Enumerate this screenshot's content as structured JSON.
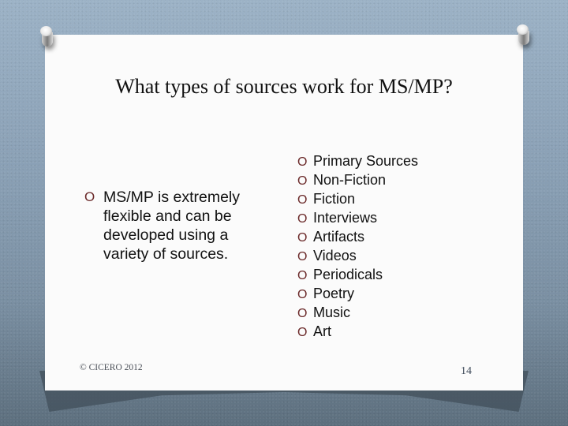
{
  "slide": {
    "title": "What types of sources work for MS/MP?",
    "left_bullet": {
      "glyph": "O",
      "text": "MS/MP is extremely flexible and can be developed using a variety of sources."
    },
    "source_types": [
      {
        "glyph": "O",
        "label": "Primary Sources"
      },
      {
        "glyph": "O",
        "label": "Non-Fiction"
      },
      {
        "glyph": "O",
        "label": "Fiction"
      },
      {
        "glyph": "O",
        "label": "Interviews"
      },
      {
        "glyph": "O",
        "label": "Artifacts"
      },
      {
        "glyph": "O",
        "label": "Videos"
      },
      {
        "glyph": "O",
        "label": "Periodicals"
      },
      {
        "glyph": "O",
        "label": "Poetry"
      },
      {
        "glyph": "O",
        "label": "Music"
      },
      {
        "glyph": "O",
        "label": "Art"
      }
    ],
    "footer": {
      "copyright": "© CICERO 2012",
      "page_number": "14"
    },
    "colors": {
      "bullet": "#6b2a2a",
      "paper": "#fbfbfb",
      "background": "#8aa0b5"
    }
  }
}
